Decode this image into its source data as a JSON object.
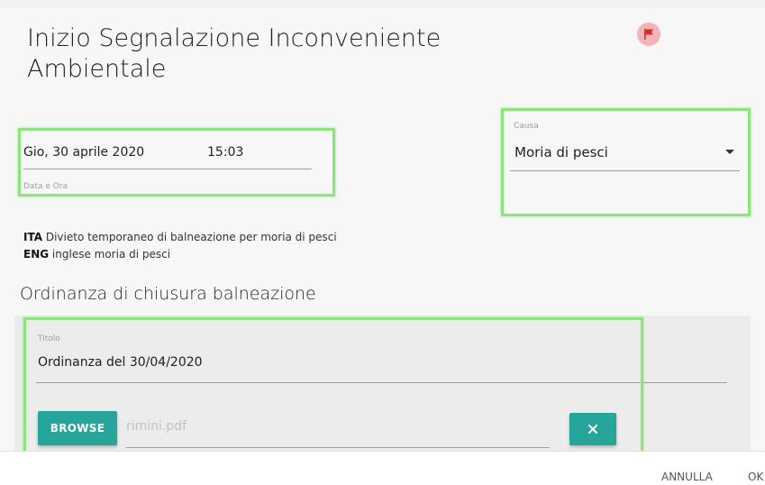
{
  "header": {
    "title": "Inizio Segnalazione Inconveniente Ambientale",
    "flag_icon": "flag-icon",
    "flag_color": "#d32f2f"
  },
  "datetime": {
    "date": "Gio, 30 aprile 2020",
    "time": "15:03",
    "label": "Data e Ora"
  },
  "cause": {
    "label": "Causa",
    "value": "Moria di pesci"
  },
  "descriptions": [
    {
      "lang": "ITA",
      "text": "Divieto temporaneo di balneazione per moria di pesci"
    },
    {
      "lang": "ENG",
      "text": "inglese moria di pesci"
    }
  ],
  "ordinance": {
    "section_title": "Ordinanza di chiusura balneazione",
    "title_label": "Titolo",
    "title_value": "Ordinanza del 30/04/2020",
    "browse_label": "BROWSE",
    "file_name": "rimini.pdf",
    "clear_icon": "close-icon"
  },
  "footer": {
    "cancel_label": "ANNULLA",
    "ok_label": "OK"
  },
  "colors": {
    "accent": "#26a69a",
    "highlight": "#8de37c"
  }
}
